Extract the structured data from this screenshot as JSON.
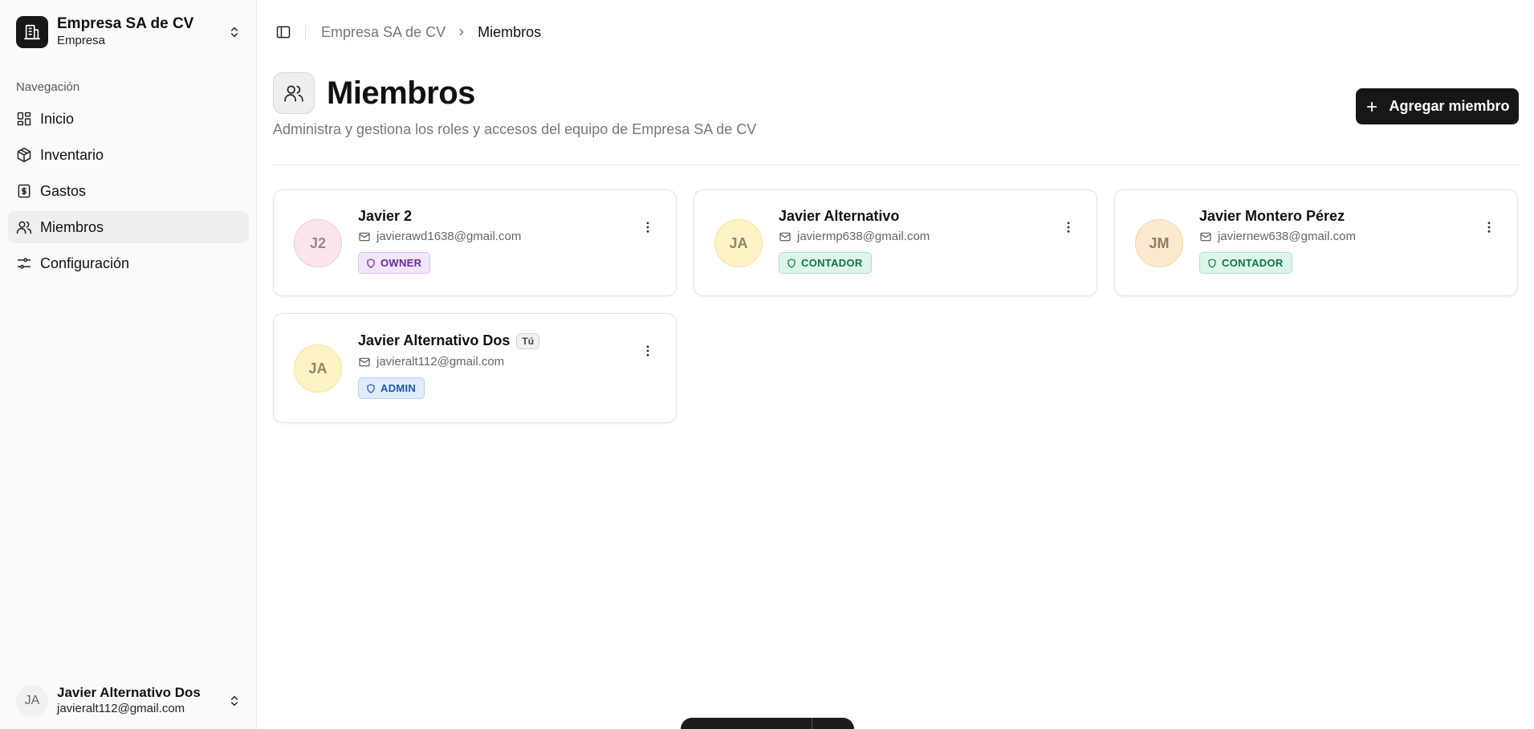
{
  "sidebar": {
    "org": {
      "name": "Empresa SA de CV",
      "subtitle": "Empresa"
    },
    "nav_title": "Navegación",
    "items": [
      {
        "label": "Inicio",
        "icon": "dashboard-icon"
      },
      {
        "label": "Inventario",
        "icon": "package-icon"
      },
      {
        "label": "Gastos",
        "icon": "receipt-dollar-icon"
      },
      {
        "label": "Miembros",
        "icon": "users-icon",
        "active": true
      },
      {
        "label": "Configuración",
        "icon": "sliders-icon"
      }
    ],
    "user": {
      "initials": "JA",
      "name": "Javier Alternativo Dos",
      "email": "javieralt112@gmail.com"
    }
  },
  "breadcrumb": {
    "parent": "Empresa SA de CV",
    "current": "Miembros"
  },
  "header": {
    "title": "Miembros",
    "description": "Administra y gestiona los roles y accesos del equipo de Empresa SA de CV",
    "add_button_label": "Agregar miembro"
  },
  "members": [
    {
      "initials": "J2",
      "name": "Javier 2",
      "email": "javierawd1638@gmail.com",
      "role": "OWNER"
    },
    {
      "initials": "JA",
      "name": "Javier Alternativo",
      "email": "javiermp638@gmail.com",
      "role": "CONTADOR"
    },
    {
      "initials": "JM",
      "name": "Javier Montero Pérez",
      "email": "javiernew638@gmail.com",
      "role": "CONTADOR"
    },
    {
      "initials": "JA",
      "name": "Javier Alternativo Dos",
      "email": "javieralt112@gmail.com",
      "role": "ADMIN",
      "self_badge": "Tú"
    }
  ],
  "colors": {
    "primary": "#171717",
    "owner": "#6a2a9a",
    "contador": "#16704a",
    "admin": "#1f56a8"
  }
}
